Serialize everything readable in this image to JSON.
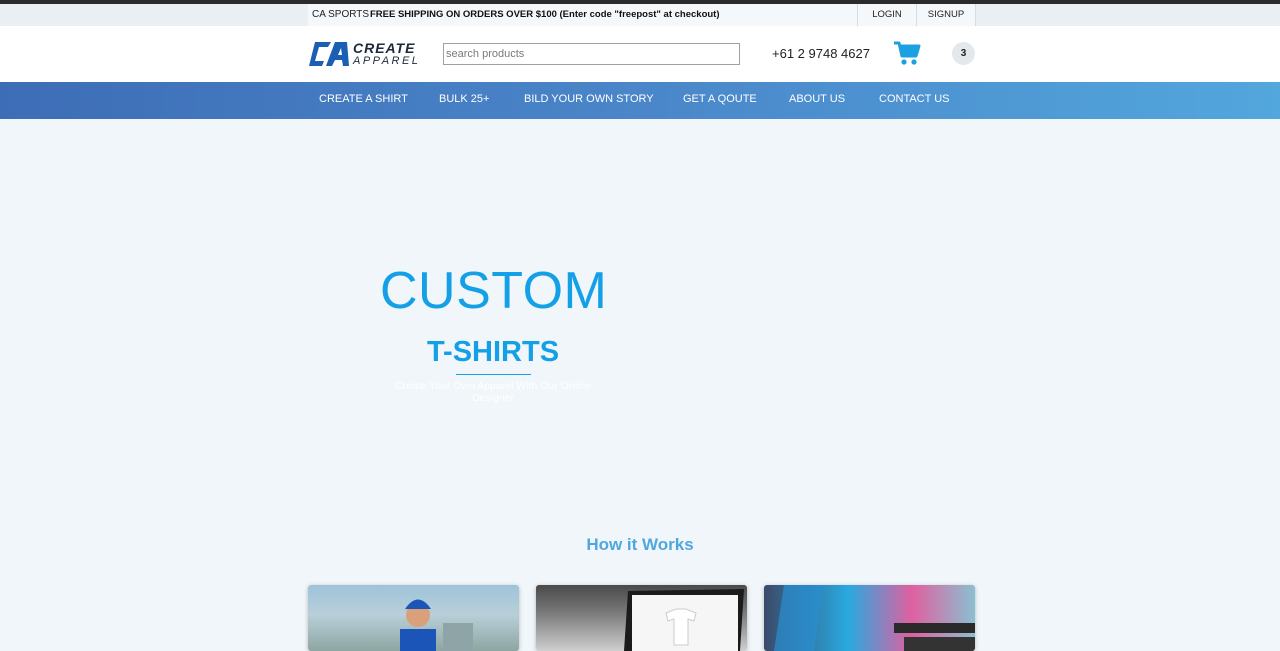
{
  "topbar": {
    "brand": "CA SPORTS",
    "promo": "FREE SHIPPING ON ORDERS OVER $100 (Enter code \"freepost\" at checkout)",
    "login": "LOGIN",
    "signup": "SIGNUP"
  },
  "header": {
    "logo_line1": "CREATE",
    "logo_line2": "APPAREL",
    "search_placeholder": "search products",
    "phone": "+61 2 9748 4627",
    "cart_count": "3",
    "cart_icon": "shopping-cart-icon"
  },
  "nav": {
    "items": [
      "CREATE A SHIRT",
      "BULK 25+",
      "BILD YOUR OWN STORY",
      "GET A QOUTE",
      "ABOUT US",
      "CONTACT US"
    ]
  },
  "hero": {
    "title": "CUSTOM",
    "subtitle": "T-SHIRTS",
    "tagline": "Create Your Own Apparel With Our Online Designer"
  },
  "how": {
    "title": "How it Works"
  },
  "colors": {
    "accent": "#14a0e6",
    "nav_start": "#3d6db6",
    "nav_end": "#52a7dd",
    "cart": "#1ba1e2"
  }
}
